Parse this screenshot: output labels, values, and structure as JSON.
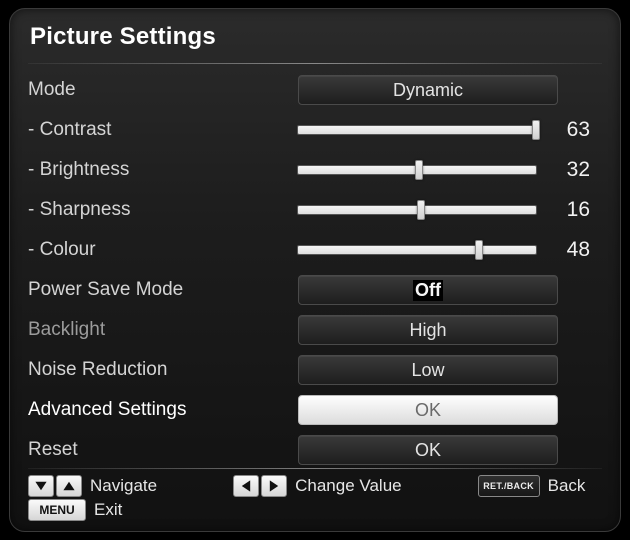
{
  "title": "Picture Settings",
  "rows": {
    "mode": {
      "label": "Mode",
      "value": "Dynamic"
    },
    "contrast": {
      "label": "- Contrast",
      "value": 63,
      "max": 63
    },
    "brightness": {
      "label": "- Brightness",
      "value": 32,
      "max": 63
    },
    "sharpness": {
      "label": "- Sharpness",
      "value": 16,
      "max": 31
    },
    "colour": {
      "label": "- Colour",
      "value": 48,
      "max": 63
    },
    "powersave": {
      "label": "Power Save Mode",
      "value": "Off"
    },
    "backlight": {
      "label": "Backlight",
      "value": "High"
    },
    "noise": {
      "label": "Noise Reduction",
      "value": "Low"
    },
    "advanced": {
      "label": "Advanced Settings",
      "value": "OK"
    },
    "reset": {
      "label": "Reset",
      "value": "OK"
    }
  },
  "footer": {
    "navigate": "Navigate",
    "change": "Change Value",
    "back": "Back",
    "exit": "Exit",
    "menu_key": "MENU",
    "retback_key": "RET./BACK"
  }
}
